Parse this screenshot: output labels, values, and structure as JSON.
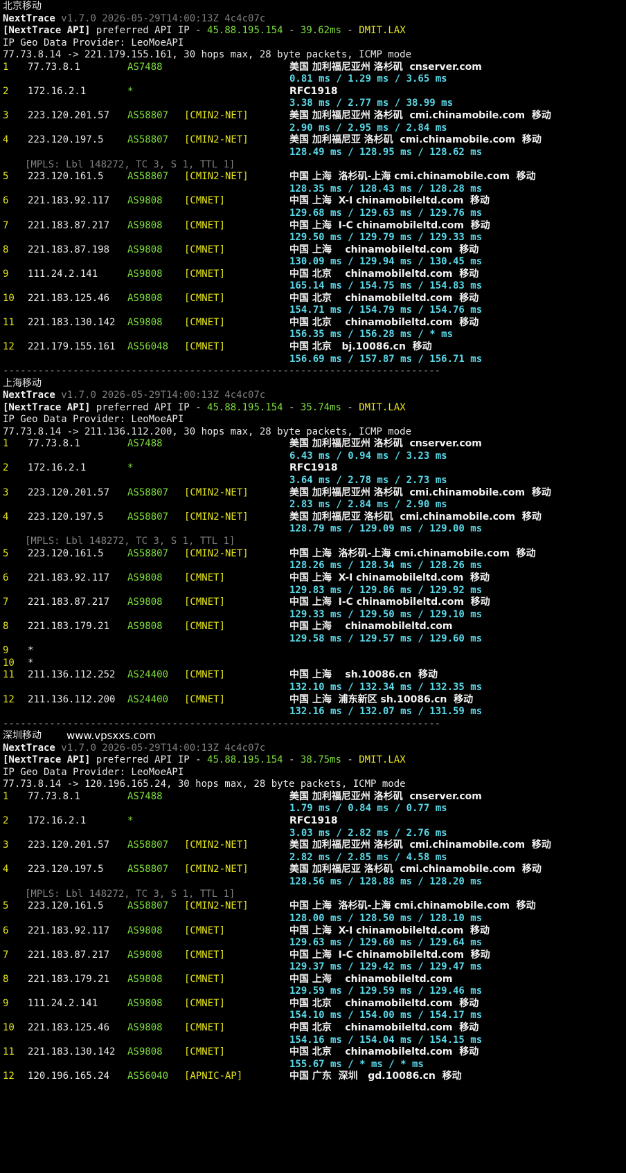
{
  "watermark": "www.vpsxxs.com",
  "separator": "---------------------------------------------------------------------------",
  "sections": [
    {
      "title": "北京移动",
      "nt_name": "NextTrace",
      "nt_version": "v1.7.0 2026-05-29T14:00:13Z 4c4c07c",
      "api_label": "[NextTrace API]",
      "api_text": "preferred API IP -",
      "api_ip": "45.88.195.154",
      "api_ms": "39.62ms",
      "api_node": "DMIT.LAX",
      "provider": "IP Geo Data Provider: LeoMoeAPI",
      "trace_line": "77.73.8.14 -> 221.179.155.161, 30 hops max, 28 byte packets, ICMP mode",
      "hops": [
        {
          "n": "1",
          "ip": "77.73.8.1",
          "as": "AS7488",
          "tag": "",
          "geo": "美国 加利福尼亚州 洛杉矶  cnserver.com",
          "time": "0.81 ms / 1.29 ms / 3.65 ms"
        },
        {
          "n": "2",
          "ip": "172.16.2.1",
          "as": "*",
          "tag": "",
          "geo": "RFC1918",
          "time": "3.38 ms / 2.77 ms / 38.99 ms"
        },
        {
          "n": "3",
          "ip": "223.120.201.57",
          "as": "AS58807",
          "tag": "[CMIN2-NET]",
          "geo": "美国 加利福尼亚州 洛杉矶  cmi.chinamobile.com  移动",
          "time": "2.90 ms / 2.95 ms / 2.84 ms"
        },
        {
          "n": "4",
          "ip": "223.120.197.5",
          "as": "AS58807",
          "tag": "[CMIN2-NET]",
          "geo": "美国 加利福尼亚 洛杉矶  cmi.chinamobile.com  移动",
          "time": "128.49 ms / 128.95 ms / 128.62 ms",
          "mpls": "[MPLS: Lbl 148272, TC 3, S 1, TTL 1]"
        },
        {
          "n": "5",
          "ip": "223.120.161.5",
          "as": "AS58807",
          "tag": "[CMIN2-NET]",
          "geo": "中国 上海  洛杉矶-上海 cmi.chinamobile.com  移动",
          "time": "128.35 ms / 128.43 ms / 128.28 ms"
        },
        {
          "n": "6",
          "ip": "221.183.92.117",
          "as": "AS9808",
          "tag": "[CMNET]",
          "geo": "中国 上海  X-I chinamobileltd.com  移动",
          "time": "129.68 ms / 129.63 ms / 129.76 ms"
        },
        {
          "n": "7",
          "ip": "221.183.87.217",
          "as": "AS9808",
          "tag": "[CMNET]",
          "geo": "中国 上海  I-C chinamobileltd.com  移动",
          "time": "129.50 ms / 129.79 ms / 129.33 ms"
        },
        {
          "n": "8",
          "ip": "221.183.87.198",
          "as": "AS9808",
          "tag": "[CMNET]",
          "geo": "中国 上海    chinamobileltd.com  移动",
          "time": "130.09 ms / 129.94 ms / 130.45 ms"
        },
        {
          "n": "9",
          "ip": "111.24.2.141",
          "as": "AS9808",
          "tag": "[CMNET]",
          "geo": "中国 北京    chinamobileltd.com  移动",
          "time": "165.14 ms / 154.75 ms / 154.83 ms"
        },
        {
          "n": "10",
          "ip": "221.183.125.46",
          "as": "AS9808",
          "tag": "[CMNET]",
          "geo": "中国 北京    chinamobileltd.com  移动",
          "time": "154.71 ms / 154.79 ms / 154.76 ms"
        },
        {
          "n": "11",
          "ip": "221.183.130.142",
          "as": "AS9808",
          "tag": "[CMNET]",
          "geo": "中国 北京    chinamobileltd.com  移动",
          "time": "156.35 ms / 156.28 ms / * ms"
        },
        {
          "n": "12",
          "ip": "221.179.155.161",
          "as": "AS56048",
          "tag": "[CMNET]",
          "geo": "中国 北京   bj.10086.cn  移动",
          "time": "156.69 ms / 157.87 ms / 156.71 ms"
        }
      ]
    },
    {
      "title": "上海移动",
      "nt_name": "NextTrace",
      "nt_version": "v1.7.0 2026-05-29T14:00:13Z 4c4c07c",
      "api_label": "[NextTrace API]",
      "api_text": "preferred API IP -",
      "api_ip": "45.88.195.154",
      "api_ms": "35.74ms",
      "api_node": "DMIT.LAX",
      "provider": "IP Geo Data Provider: LeoMoeAPI",
      "trace_line": "77.73.8.14 -> 211.136.112.200, 30 hops max, 28 byte packets, ICMP mode",
      "hops": [
        {
          "n": "1",
          "ip": "77.73.8.1",
          "as": "AS7488",
          "tag": "",
          "geo": "美国 加利福尼亚州 洛杉矶  cnserver.com",
          "time": "6.43 ms / 0.94 ms / 3.23 ms"
        },
        {
          "n": "2",
          "ip": "172.16.2.1",
          "as": "*",
          "tag": "",
          "geo": "RFC1918",
          "time": "3.64 ms / 2.78 ms / 2.73 ms"
        },
        {
          "n": "3",
          "ip": "223.120.201.57",
          "as": "AS58807",
          "tag": "[CMIN2-NET]",
          "geo": "美国 加利福尼亚州 洛杉矶  cmi.chinamobile.com  移动",
          "time": "2.83 ms / 2.84 ms / 2.90 ms"
        },
        {
          "n": "4",
          "ip": "223.120.197.5",
          "as": "AS58807",
          "tag": "[CMIN2-NET]",
          "geo": "美国 加利福尼亚 洛杉矶  cmi.chinamobile.com  移动",
          "time": "128.79 ms / 129.09 ms / 129.00 ms",
          "mpls": "[MPLS: Lbl 148272, TC 3, S 1, TTL 1]"
        },
        {
          "n": "5",
          "ip": "223.120.161.5",
          "as": "AS58807",
          "tag": "[CMIN2-NET]",
          "geo": "中国 上海  洛杉矶-上海 cmi.chinamobile.com  移动",
          "time": "128.26 ms / 128.34 ms / 128.26 ms"
        },
        {
          "n": "6",
          "ip": "221.183.92.117",
          "as": "AS9808",
          "tag": "[CMNET]",
          "geo": "中国 上海  X-I chinamobileltd.com  移动",
          "time": "129.83 ms / 129.86 ms / 129.92 ms"
        },
        {
          "n": "7",
          "ip": "221.183.87.217",
          "as": "AS9808",
          "tag": "[CMNET]",
          "geo": "中国 上海  I-C chinamobileltd.com  移动",
          "time": "129.33 ms / 129.50 ms / 129.10 ms"
        },
        {
          "n": "8",
          "ip": "221.183.179.21",
          "as": "AS9808",
          "tag": "[CMNET]",
          "geo": "中国 上海    chinamobileltd.com",
          "time": "129.58 ms / 129.57 ms / 129.60 ms"
        },
        {
          "n": "9",
          "ip": "*",
          "as": "",
          "tag": "",
          "geo": "",
          "time": ""
        },
        {
          "n": "10",
          "ip": "*",
          "as": "",
          "tag": "",
          "geo": "",
          "time": ""
        },
        {
          "n": "11",
          "ip": "211.136.112.252",
          "as": "AS24400",
          "tag": "[CMNET]",
          "geo": "中国 上海    sh.10086.cn  移动",
          "time": "132.10 ms / 132.34 ms / 132.35 ms"
        },
        {
          "n": "12",
          "ip": "211.136.112.200",
          "as": "AS24400",
          "tag": "[CMNET]",
          "geo": "中国 上海  浦东新区 sh.10086.cn  移动",
          "time": "132.16 ms / 132.07 ms / 131.59 ms"
        }
      ]
    },
    {
      "title": "深圳移动",
      "nt_name": "NextTrace",
      "nt_version": "v1.7.0 2026-05-29T14:00:13Z 4c4c07c",
      "api_label": "[NextTrace API]",
      "api_text": "preferred API IP -",
      "api_ip": "45.88.195.154",
      "api_ms": "38.75ms",
      "api_node": "DMIT.LAX",
      "provider": "IP Geo Data Provider: LeoMoeAPI",
      "trace_line": "77.73.8.14 -> 120.196.165.24, 30 hops max, 28 byte packets, ICMP mode",
      "hops": [
        {
          "n": "1",
          "ip": "77.73.8.1",
          "as": "AS7488",
          "tag": "",
          "geo": "美国 加利福尼亚州 洛杉矶  cnserver.com",
          "time": "1.79 ms / 0.84 ms / 0.77 ms"
        },
        {
          "n": "2",
          "ip": "172.16.2.1",
          "as": "*",
          "tag": "",
          "geo": "RFC1918",
          "time": "3.03 ms / 2.82 ms / 2.76 ms"
        },
        {
          "n": "3",
          "ip": "223.120.201.57",
          "as": "AS58807",
          "tag": "[CMIN2-NET]",
          "geo": "美国 加利福尼亚州 洛杉矶  cmi.chinamobile.com  移动",
          "time": "2.82 ms / 2.85 ms / 4.58 ms"
        },
        {
          "n": "4",
          "ip": "223.120.197.5",
          "as": "AS58807",
          "tag": "[CMIN2-NET]",
          "geo": "美国 加利福尼亚 洛杉矶  cmi.chinamobile.com  移动",
          "time": "128.56 ms / 128.88 ms / 128.20 ms",
          "mpls": "[MPLS: Lbl 148272, TC 3, S 1, TTL 1]"
        },
        {
          "n": "5",
          "ip": "223.120.161.5",
          "as": "AS58807",
          "tag": "[CMIN2-NET]",
          "geo": "中国 上海  洛杉矶-上海 cmi.chinamobile.com  移动",
          "time": "128.00 ms / 128.50 ms / 128.10 ms"
        },
        {
          "n": "6",
          "ip": "221.183.92.117",
          "as": "AS9808",
          "tag": "[CMNET]",
          "geo": "中国 上海  X-I chinamobileltd.com  移动",
          "time": "129.63 ms / 129.60 ms / 129.64 ms"
        },
        {
          "n": "7",
          "ip": "221.183.87.217",
          "as": "AS9808",
          "tag": "[CMNET]",
          "geo": "中国 上海  I-C chinamobileltd.com  移动",
          "time": "129.37 ms / 129.42 ms / 129.47 ms"
        },
        {
          "n": "8",
          "ip": "221.183.179.21",
          "as": "AS9808",
          "tag": "[CMNET]",
          "geo": "中国 上海    chinamobileltd.com",
          "time": "129.59 ms / 129.59 ms / 129.46 ms"
        },
        {
          "n": "9",
          "ip": "111.24.2.141",
          "as": "AS9808",
          "tag": "[CMNET]",
          "geo": "中国 北京    chinamobileltd.com  移动",
          "time": "154.10 ms / 154.00 ms / 154.17 ms"
        },
        {
          "n": "10",
          "ip": "221.183.125.46",
          "as": "AS9808",
          "tag": "[CMNET]",
          "geo": "中国 北京    chinamobileltd.com  移动",
          "time": "154.16 ms / 154.04 ms / 154.15 ms"
        },
        {
          "n": "11",
          "ip": "221.183.130.142",
          "as": "AS9808",
          "tag": "[CMNET]",
          "geo": "中国 北京    chinamobileltd.com  移动",
          "time": "155.67 ms / * ms / * ms"
        },
        {
          "n": "12",
          "ip": "120.196.165.24",
          "as": "AS56040",
          "tag": "[APNIC-AP]",
          "geo": "中国 广东  深圳   gd.10086.cn  移动",
          "time": ""
        }
      ]
    }
  ]
}
